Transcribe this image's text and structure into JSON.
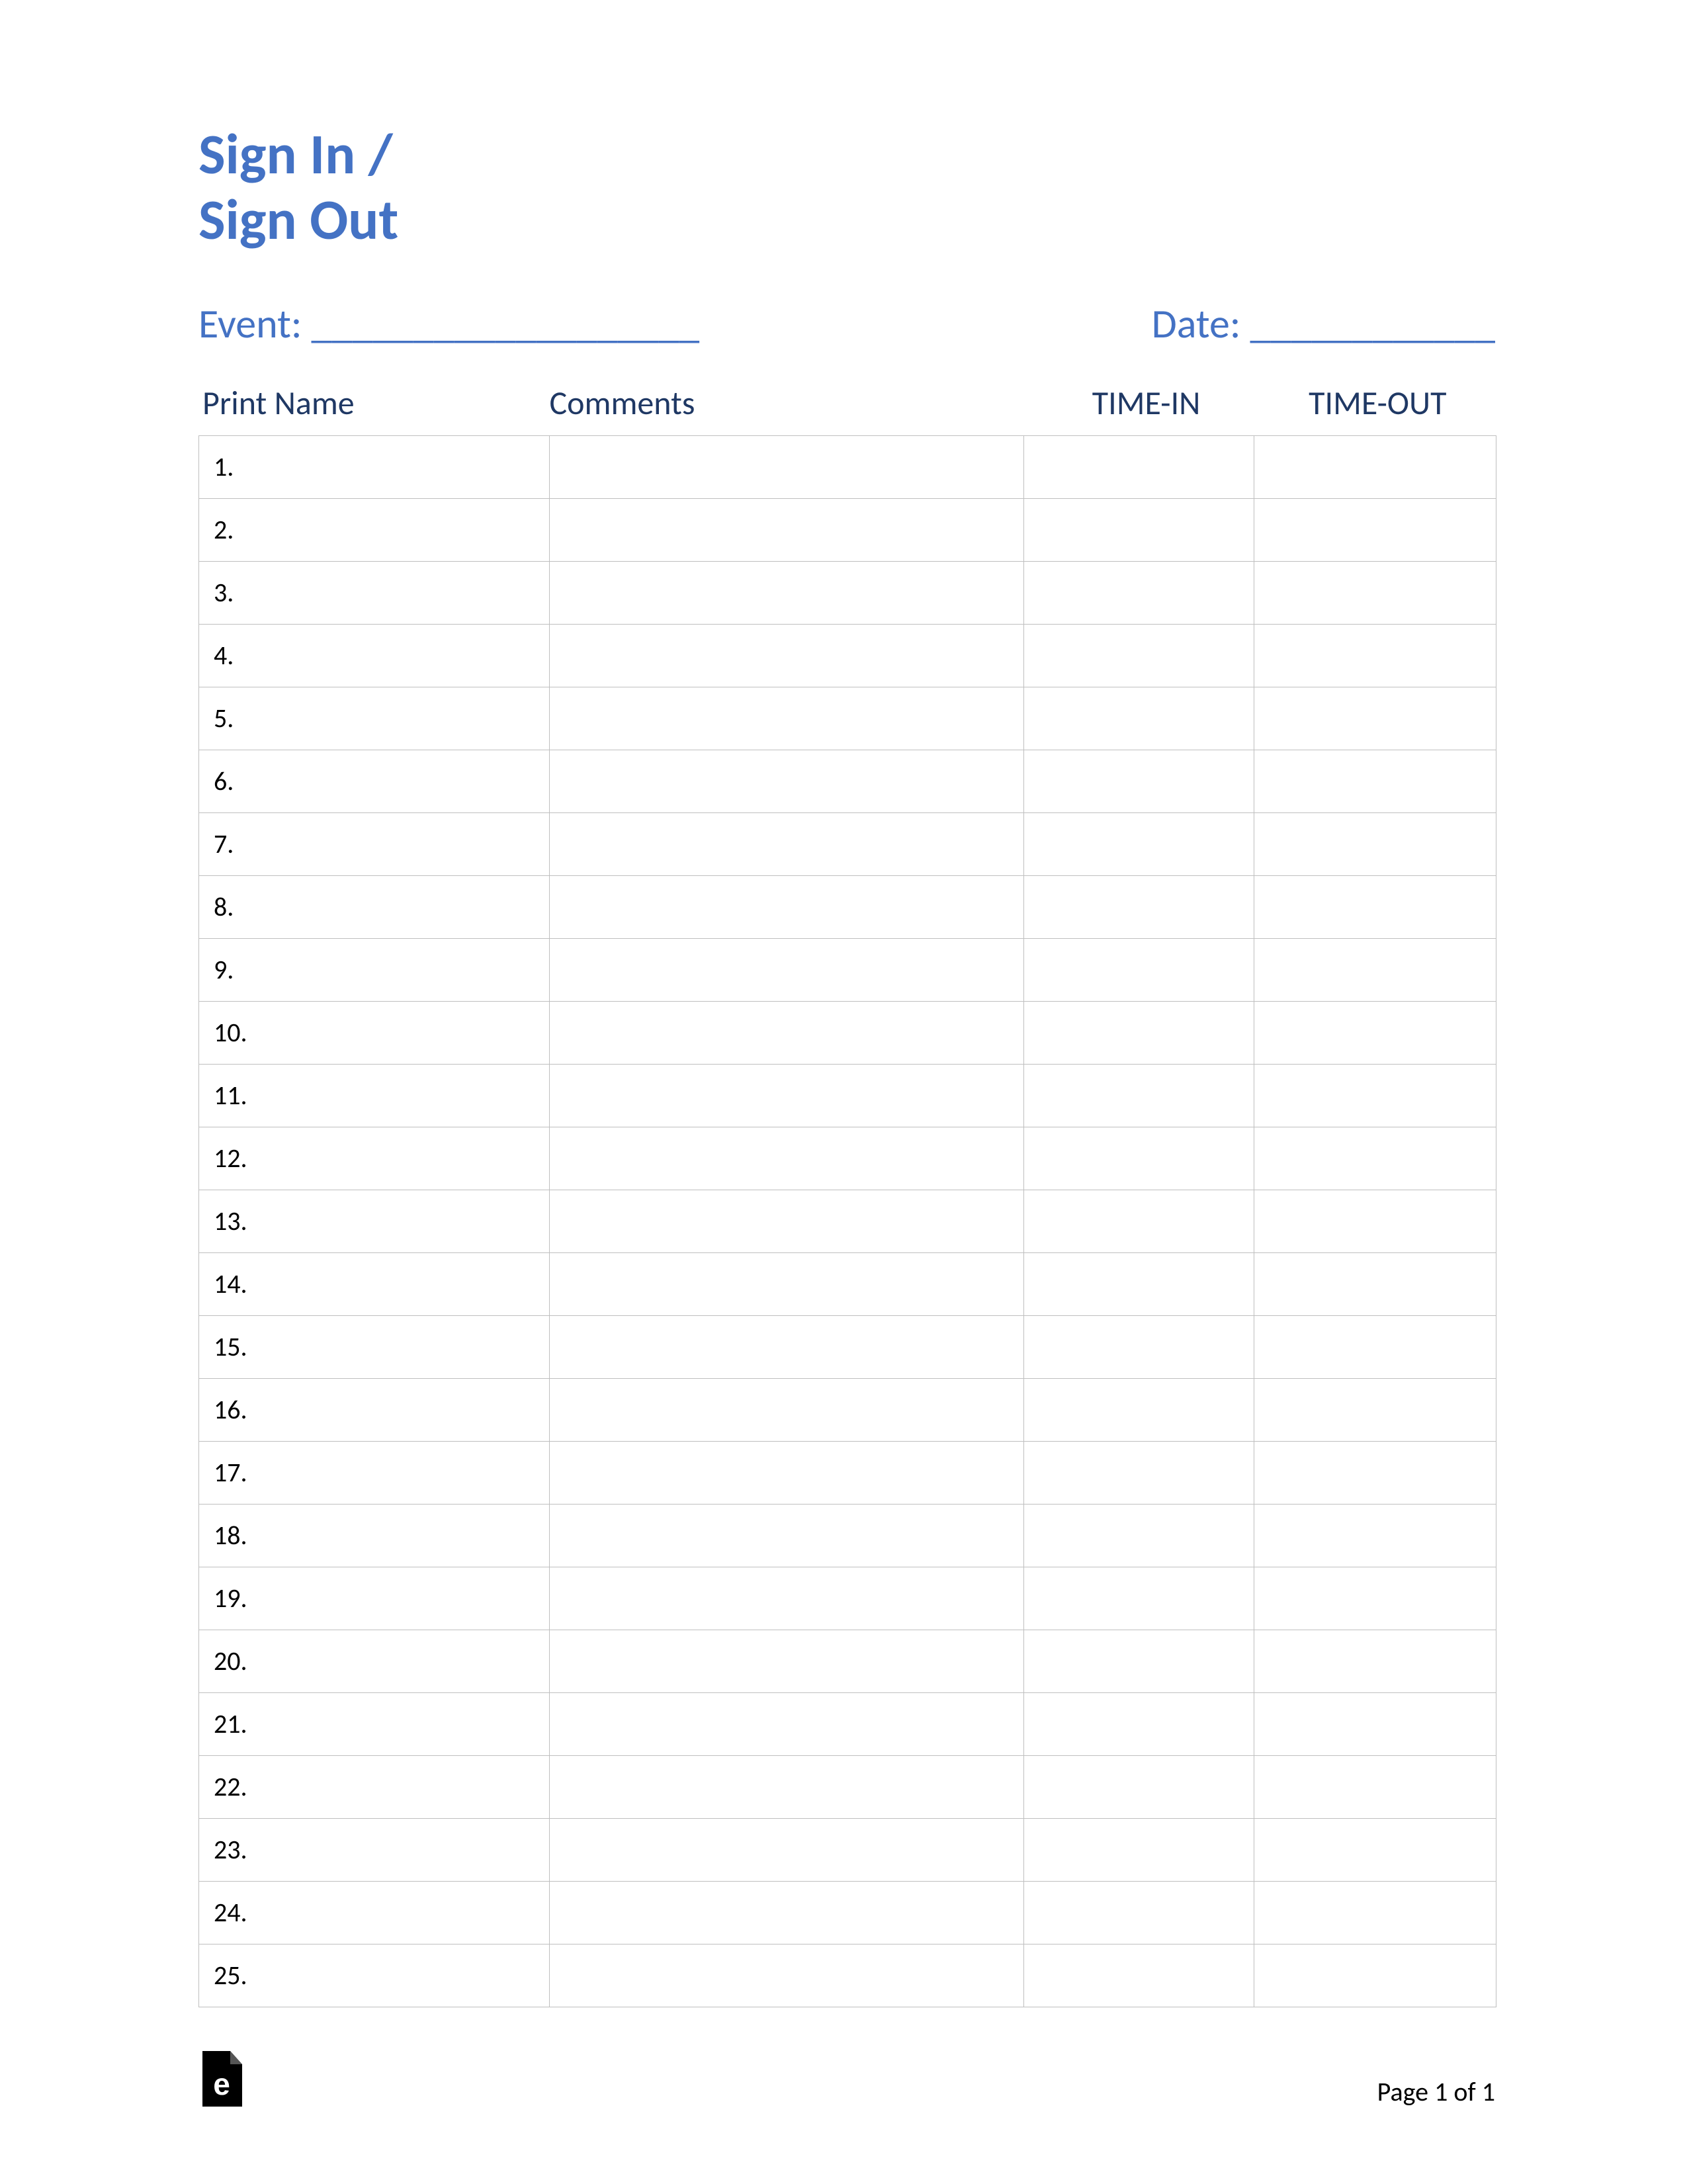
{
  "title": {
    "line1": "Sign In /",
    "line2": "Sign Out"
  },
  "meta": {
    "event_label": "Event: ___________________",
    "date_label": "Date: ____________"
  },
  "columns": {
    "name": "Print Name",
    "comments": "Comments",
    "time_in": "TIME-IN",
    "time_out": "TIME-OUT"
  },
  "rows": [
    {
      "num": "1."
    },
    {
      "num": "2."
    },
    {
      "num": "3."
    },
    {
      "num": "4."
    },
    {
      "num": "5."
    },
    {
      "num": "6."
    },
    {
      "num": "7."
    },
    {
      "num": "8."
    },
    {
      "num": "9."
    },
    {
      "num": "10."
    },
    {
      "num": "11."
    },
    {
      "num": "12."
    },
    {
      "num": "13."
    },
    {
      "num": "14."
    },
    {
      "num": "15."
    },
    {
      "num": "16."
    },
    {
      "num": "17."
    },
    {
      "num": "18."
    },
    {
      "num": "19."
    },
    {
      "num": "20."
    },
    {
      "num": "21."
    },
    {
      "num": "22."
    },
    {
      "num": "23."
    },
    {
      "num": "24."
    },
    {
      "num": "25."
    }
  ],
  "footer": {
    "page_label": "Page 1 of 1"
  }
}
